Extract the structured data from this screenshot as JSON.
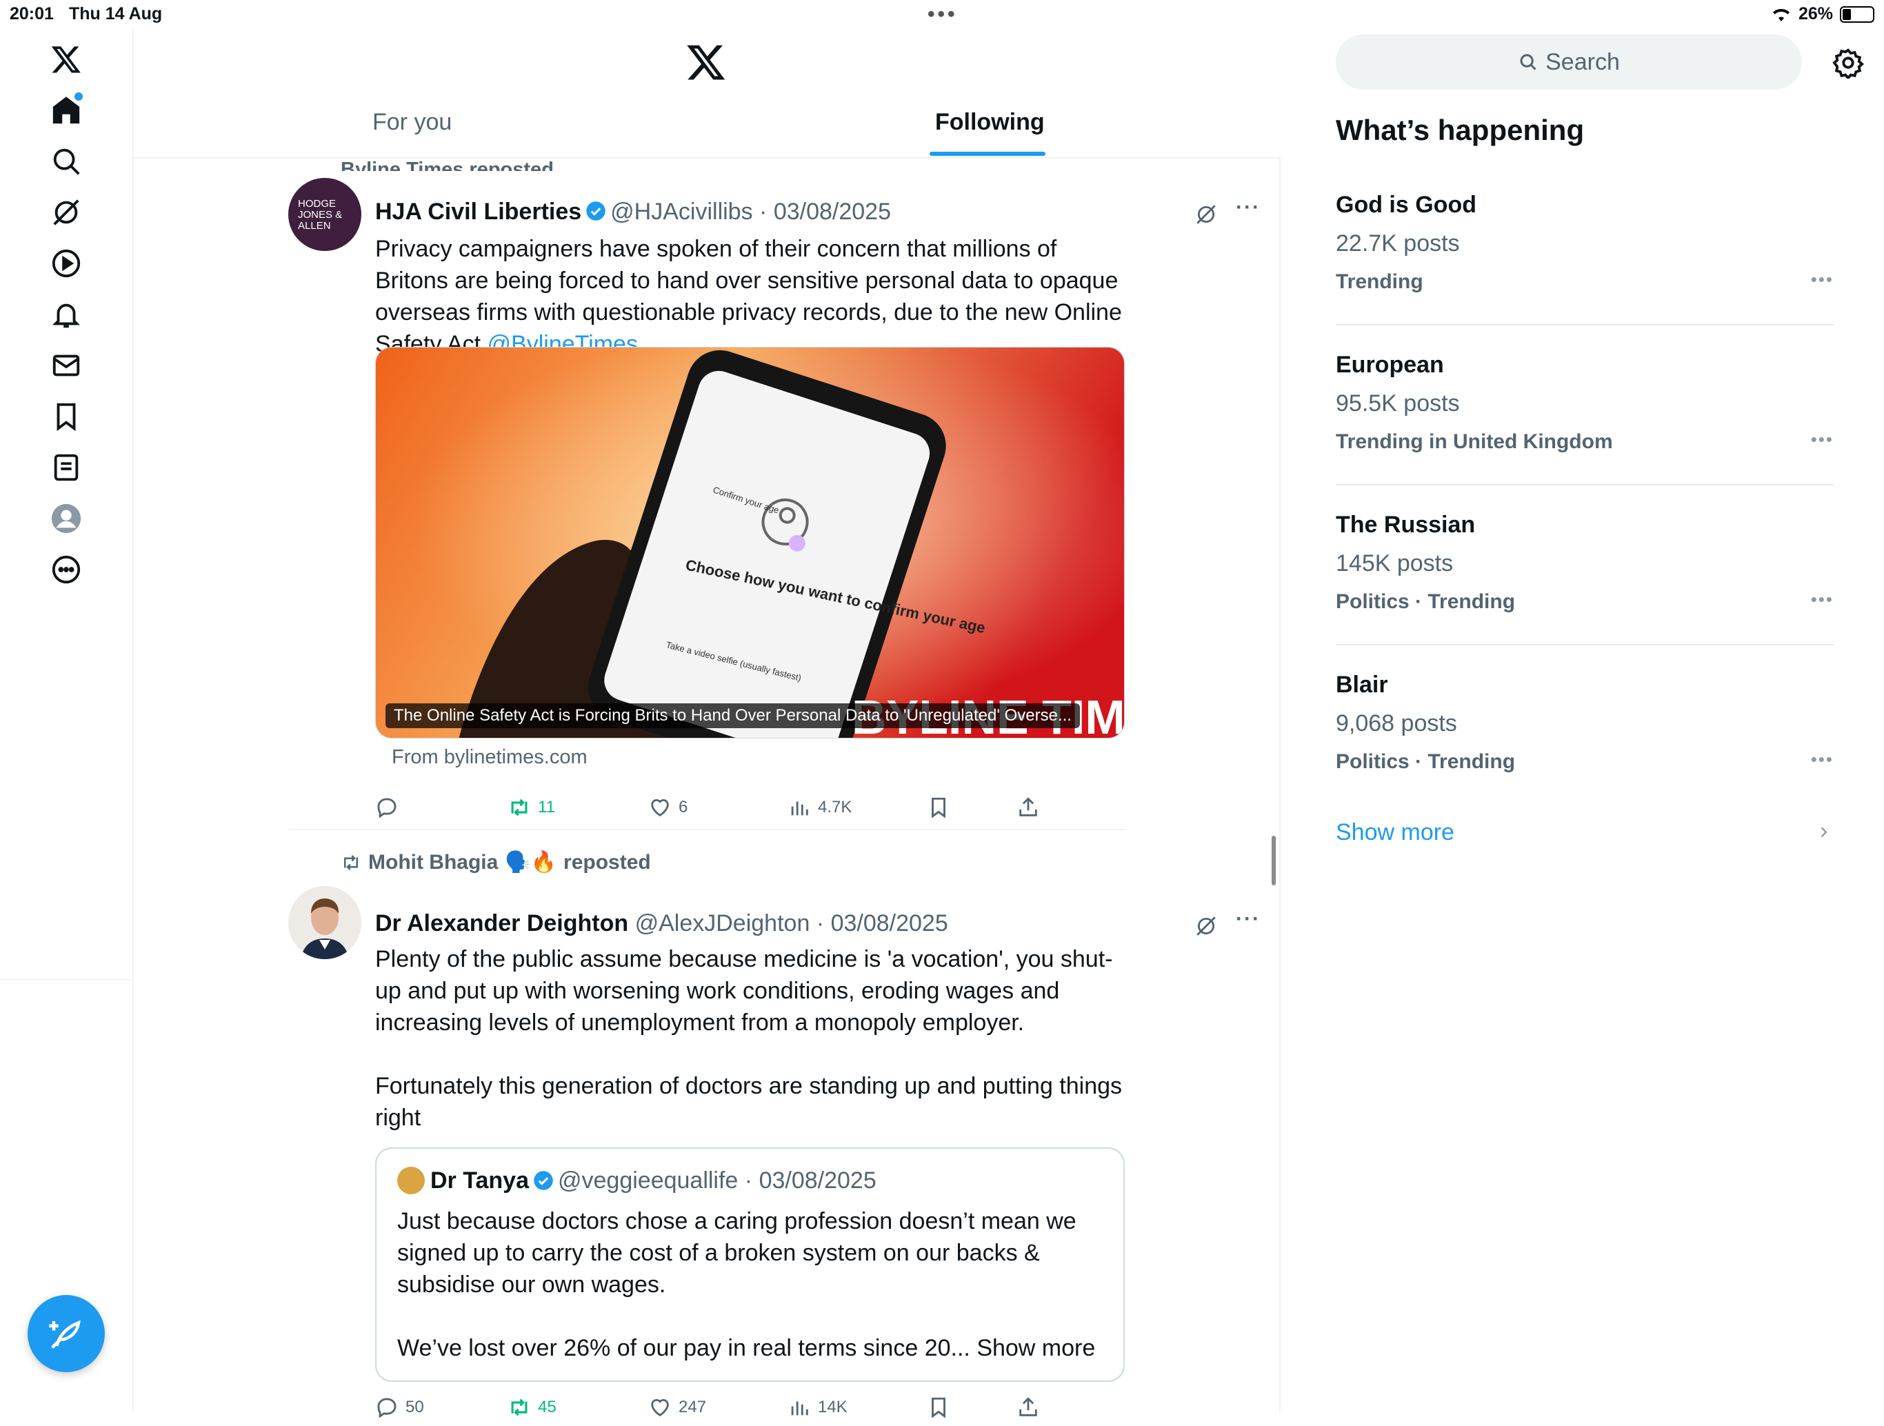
{
  "status_bar": {
    "time": "20:01",
    "date": "Thu 14 Aug",
    "battery": "26%"
  },
  "tabs": {
    "for_you": "For you",
    "following": "Following"
  },
  "partial_repost": "Byline Times reposted",
  "post1": {
    "avatar_text": "HODGE JONES & ALLEN",
    "name": "HJA Civil Liberties",
    "handle": "@HJAcivillibs",
    "date": "03/08/2025",
    "text": "Privacy campaigners have spoken of their concern that millions of Britons are being forced to hand over sensitive personal data to opaque overseas firms with questionable privacy records, due to the new Online Safety Act ",
    "mention": "@BylineTimes",
    "media": {
      "phone_heading": "Confirm your age",
      "phone_title": "Choose how you want to confirm your age",
      "phone_option": "Take a video selfie (usually fastest)",
      "watermark": "BYLINE TIMES",
      "caption": "The Online Safety Act is Forcing Brits to Hand Over Personal Data to 'Unregulated' Overse...",
      "source": "From bylinetimes.com"
    },
    "stats": {
      "replies": "",
      "reposts": "11",
      "likes": "6",
      "views": "4.7K"
    }
  },
  "post2": {
    "repost_by": "Mohit Bhagia",
    "repost_emoji": "🗣️🔥",
    "repost_suffix": "reposted",
    "name": "Dr Alexander Deighton",
    "handle": "@AlexJDeighton",
    "date": "03/08/2025",
    "text": "Plenty of the public assume because medicine is 'a vocation', you shut-up and put up with worsening work conditions, eroding wages and increasing levels of unemployment from a monopoly employer.\n\nFortunately this generation of doctors are standing up and putting things right",
    "quote": {
      "name": "Dr Tanya",
      "handle": "@veggieequallife",
      "date": "03/08/2025",
      "text": "Just because doctors chose a caring profession doesn’t mean we signed up to carry the cost of a broken system on our backs & subsidise our own wages.\n\nWe’ve lost over 26% of our pay in real terms since 20... ",
      "show_more": "Show more"
    },
    "stats": {
      "replies": "50",
      "reposts": "45",
      "likes": "247",
      "views": "14K"
    }
  },
  "sidebar": {
    "search_placeholder": "Search",
    "section_title": "What’s happening",
    "trends": [
      {
        "name": "God is Good",
        "posts": "22.7K posts",
        "category": "Trending"
      },
      {
        "name": "European",
        "posts": "95.5K posts",
        "category": "Trending in United Kingdom"
      },
      {
        "name": "The Russian",
        "posts": "145K posts",
        "category": "Politics · Trending"
      },
      {
        "name": "Blair",
        "posts": "9,068 posts",
        "category": "Politics · Trending"
      }
    ],
    "show_more": "Show more"
  },
  "colors": {
    "accent": "#1d9bf0",
    "repost_green": "#00ba7c",
    "text_secondary": "#536471"
  }
}
